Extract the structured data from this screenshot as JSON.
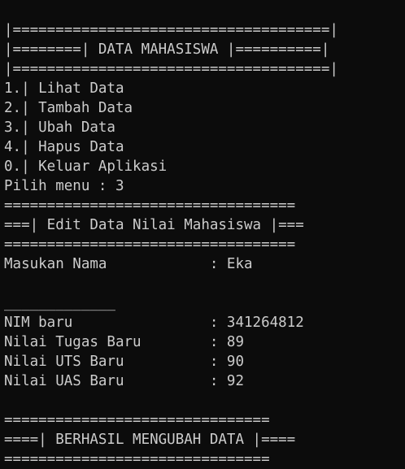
{
  "terminal": {
    "lines": [
      "|=====================================|",
      "|========| DATA MAHASISWA |==========|",
      "|=====================================|",
      "1.| Lihat Data",
      "2.| Tambah Data",
      "3.| Ubah Data",
      "4.| Hapus Data",
      "0.| Keluar Aplikasi",
      "Pilih menu : 3",
      "==================================",
      "===| Edit Data Nilai Mahasiswa |===",
      "==================================",
      "Masukan Nama            : Eka",
      "",
      "_____________",
      "NIM baru                : 341264812",
      "Nilai Tugas Baru        : 89",
      "Nilai UTS Baru          : 90",
      "Nilai UAS Baru          : 92",
      "",
      "===============================",
      "====| BERHASIL MENGUBAH DATA |====",
      "==============================="
    ]
  },
  "colors": {
    "background": "#0c0c0c",
    "text": "#cccccc"
  }
}
